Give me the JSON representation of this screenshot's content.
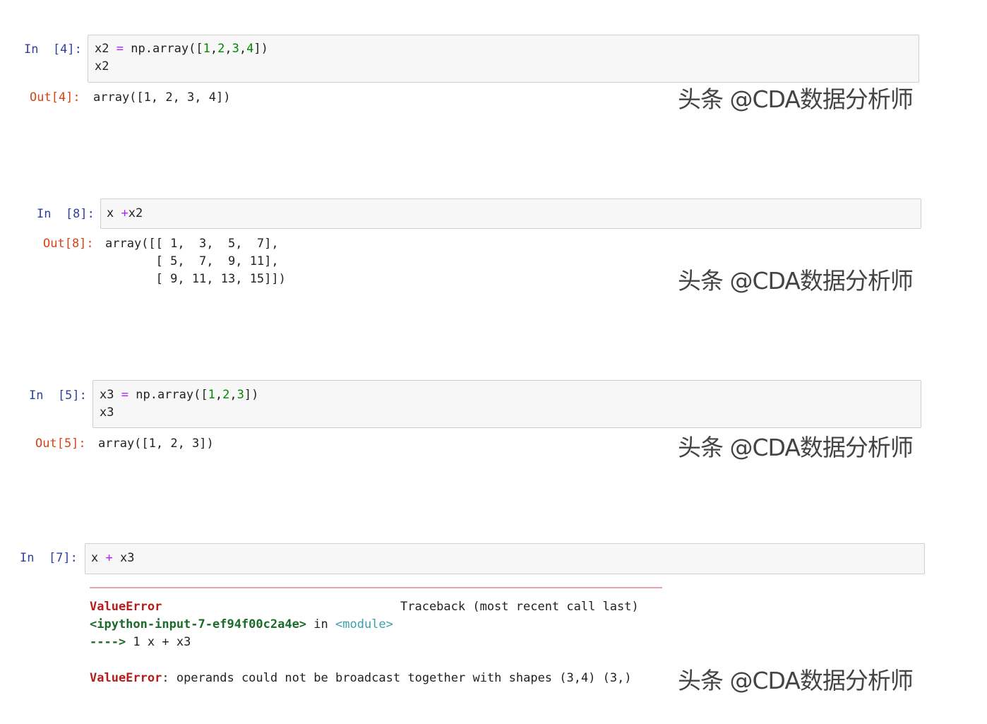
{
  "watermark": "头条 @CDA数据分析师",
  "cells": [
    {
      "in_prompt": "In  [4]:",
      "code": {
        "l1_var": "x2",
        "l1_op": "=",
        "l1_call": "np.array([",
        "l1_n1": "1",
        "l1_c1": ",",
        "l1_n2": "2",
        "l1_c2": ",",
        "l1_n3": "3",
        "l1_c3": ",",
        "l1_n4": "4",
        "l1_end": "])",
        "l2": "x2"
      },
      "out_prompt": "Out[4]:",
      "output": "array([1, 2, 3, 4])"
    },
    {
      "in_prompt": "In  [8]:",
      "code": {
        "a": "x ",
        "op": "+",
        "b": "x2"
      },
      "out_prompt": "Out[8]:",
      "output_lines": [
        "array([[ 1,  3,  5,  7],",
        "       [ 5,  7,  9, 11],",
        "       [ 9, 11, 13, 15]])"
      ]
    },
    {
      "in_prompt": "In  [5]:",
      "code": {
        "l1_var": "x3",
        "l1_op": "=",
        "l1_call": "np.array([",
        "l1_n1": "1",
        "l1_c1": ",",
        "l1_n2": "2",
        "l1_c2": ",",
        "l1_n3": "3",
        "l1_end": "])",
        "l2": "x3"
      },
      "out_prompt": "Out[5]:",
      "output": "array([1, 2, 3])"
    },
    {
      "in_prompt": "In  [7]:",
      "code": {
        "a": "x ",
        "op": "+",
        "b": " x3"
      },
      "error": {
        "type": "ValueError",
        "traceback_label": "Traceback (most recent call last)",
        "input_ref": "<ipython-input-7-ef94f00c2a4e>",
        "in_word": " in ",
        "module": "<module>",
        "arrow": "---->",
        "line_no": " 1 ",
        "line_code": "x + x3",
        "final_type": "ValueError",
        "final_msg": ": operands could not be broadcast together with shapes (3,4) (3,)"
      }
    }
  ]
}
